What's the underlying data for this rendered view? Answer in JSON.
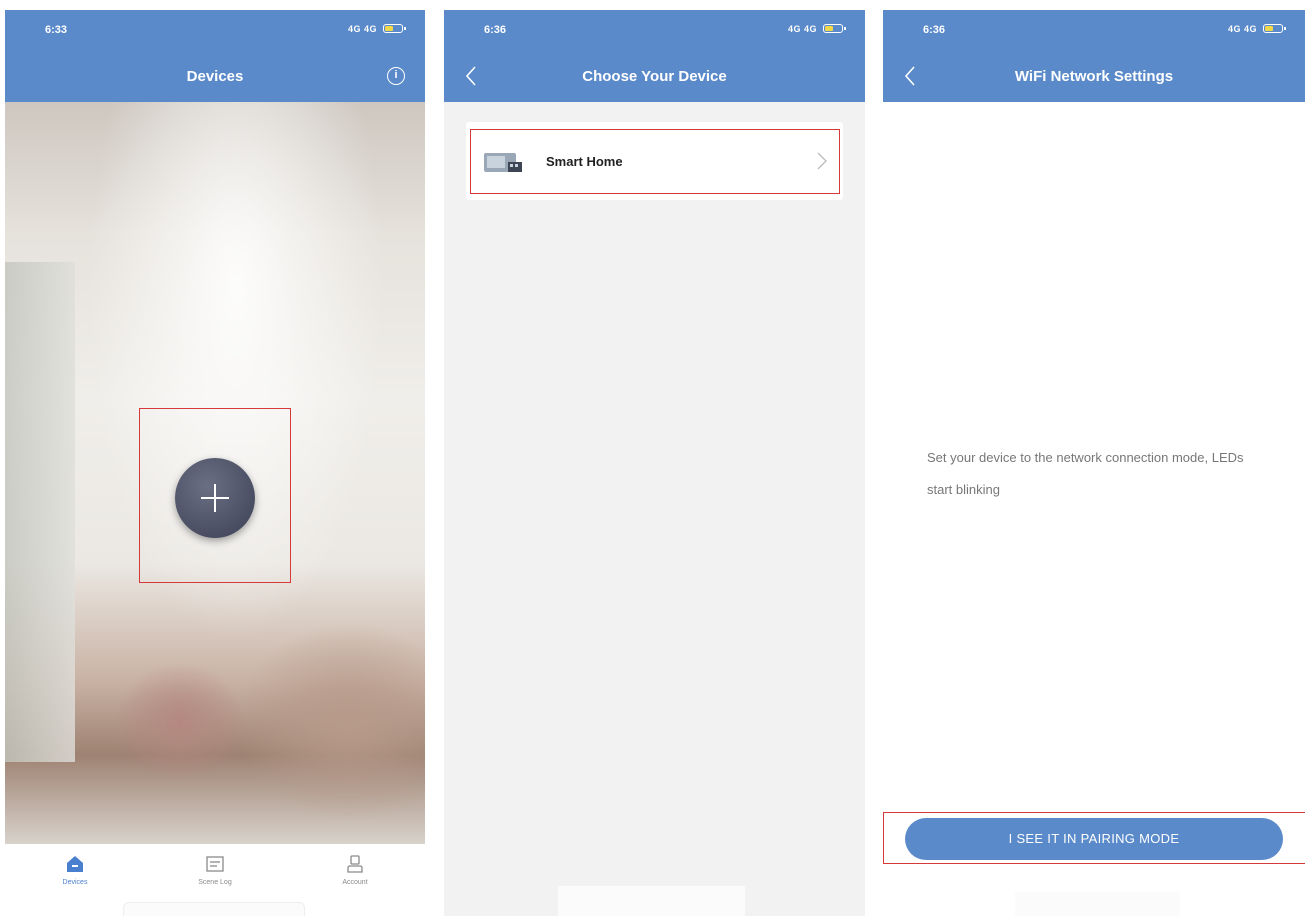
{
  "screens": [
    {
      "status": {
        "time": "6:33",
        "signal": "4G 4G"
      },
      "header": {
        "title": "Devices",
        "info_glyph": "i"
      },
      "tabs": [
        {
          "label": "Devices",
          "icon": "home-icon",
          "active": true
        },
        {
          "label": "Scene Log",
          "icon": "scene-log-icon",
          "active": false
        },
        {
          "label": "Account",
          "icon": "account-icon",
          "active": false
        }
      ]
    },
    {
      "status": {
        "time": "6:36",
        "signal": "4G 4G"
      },
      "header": {
        "title": "Choose Your Device"
      },
      "device": {
        "label": "Smart Home",
        "icon": "smart-home-device-icon"
      }
    },
    {
      "status": {
        "time": "6:36",
        "signal": "4G 4G"
      },
      "header": {
        "title": "WiFi Network Settings"
      },
      "instruction": "Set your device to the network connection mode, LEDs start blinking",
      "pair_button": "I SEE IT IN PAIRING MODE"
    }
  ],
  "colors": {
    "header": "#5a8ac9",
    "highlight": "#d6393a",
    "accent": "#4a7fd0"
  }
}
